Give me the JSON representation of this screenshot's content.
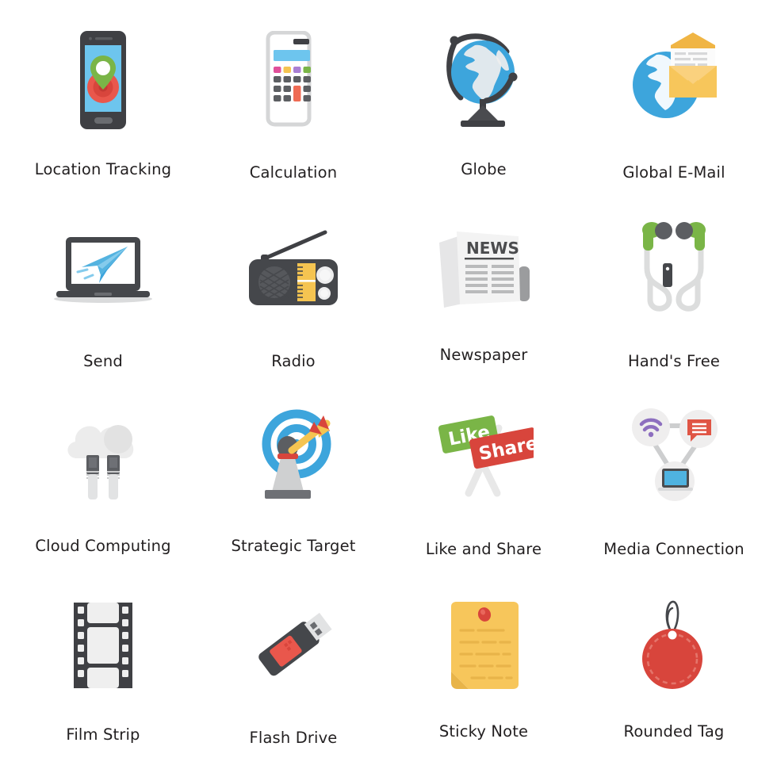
{
  "page": {
    "background": "#ffffff",
    "columns": 4,
    "rows": 4,
    "label_color": "#221f20"
  },
  "palette": {
    "dark": "#3f4044",
    "darker": "#333538",
    "blue": "#3da5dc",
    "blue_deep": "#2b8fcc",
    "light_blue": "#6dc5ee",
    "green": "#6eb945",
    "green_leaf": "#7ab547",
    "red": "#d8453c",
    "coral": "#ef6b54",
    "yellow": "#f5c451",
    "amber": "#f7c65b",
    "gray_light": "#e8e8e8",
    "gray_mid": "#cfd0d1",
    "purple": "#8d6fbf",
    "pink": "#e0509a",
    "white": "#ffffff"
  },
  "icons": [
    {
      "id": "location-tracking",
      "label": "Location Tracking",
      "row": 1,
      "col": 1
    },
    {
      "id": "calculation",
      "label": "Calculation",
      "row": 1,
      "col": 2
    },
    {
      "id": "globe",
      "label": "Globe",
      "row": 1,
      "col": 3
    },
    {
      "id": "global-email",
      "label": "Global E-Mail",
      "row": 1,
      "col": 4
    },
    {
      "id": "send",
      "label": "Send",
      "row": 2,
      "col": 1
    },
    {
      "id": "radio",
      "label": "Radio",
      "row": 2,
      "col": 2
    },
    {
      "id": "newspaper",
      "label": "Newspaper",
      "row": 2,
      "col": 3
    },
    {
      "id": "hands-free",
      "label": "Hand's Free",
      "row": 2,
      "col": 4
    },
    {
      "id": "cloud-computing",
      "label": "Cloud Computing",
      "row": 3,
      "col": 1
    },
    {
      "id": "strategic-target",
      "label": "Strategic Target",
      "row": 3,
      "col": 2
    },
    {
      "id": "like-and-share",
      "label": "Like and Share",
      "row": 3,
      "col": 3
    },
    {
      "id": "media-connection",
      "label": "Media Connection",
      "row": 3,
      "col": 4
    },
    {
      "id": "film-strip",
      "label": "Film Strip",
      "row": 4,
      "col": 1
    },
    {
      "id": "flash-drive",
      "label": "Flash Drive",
      "row": 4,
      "col": 2
    },
    {
      "id": "sticky-note",
      "label": "Sticky Note",
      "row": 4,
      "col": 3
    },
    {
      "id": "rounded-tag",
      "label": "Rounded Tag",
      "row": 4,
      "col": 4
    }
  ],
  "icon_text": {
    "newspaper_headline": "NEWS",
    "like_sign": "Like",
    "share_sign": "Share"
  }
}
